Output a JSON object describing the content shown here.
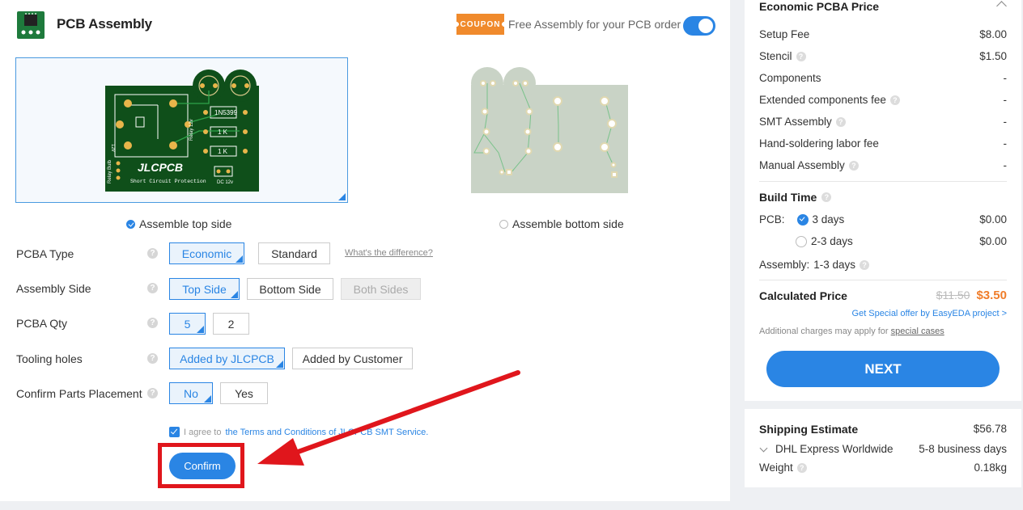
{
  "header": {
    "title": "PCB Assembly",
    "coupon_badge": "COUPON",
    "coupon_text": "Free Assembly for your PCB order"
  },
  "board": {
    "top_label": "Assemble top side",
    "bottom_label": "Assemble bottom side",
    "silkscreen": {
      "brand": "JLCPCB",
      "tagline": "Short Circuit Protection",
      "diode": "1N5399",
      "res1": "1 K",
      "res2": "1 K",
      "dc": "DC 12v",
      "relay": "Relay 12v",
      "relay_bulb": "Relay Bulb",
      "v12": "12v"
    }
  },
  "form": {
    "pcba_type": {
      "label": "PCBA Type",
      "options": [
        "Economic",
        "Standard"
      ],
      "diff_link": "What's the difference?"
    },
    "assembly_side": {
      "label": "Assembly Side",
      "options": [
        "Top Side",
        "Bottom Side",
        "Both Sides"
      ]
    },
    "pcba_qty": {
      "label": "PCBA Qty",
      "options": [
        "5",
        "2"
      ]
    },
    "tooling_holes": {
      "label": "Tooling holes",
      "options": [
        "Added by JLCPCB",
        "Added by Customer"
      ]
    },
    "confirm_placement": {
      "label": "Confirm Parts Placement",
      "options": [
        "No",
        "Yes"
      ]
    },
    "help_glyph": "?",
    "agree_prefix": "I agree to",
    "agree_terms": "the Terms and Conditions of JLCPCB SMT Service.",
    "confirm_label": "Confirm"
  },
  "price_panel": {
    "title": "Economic PCBA Price",
    "rows": [
      {
        "label": "Setup Fee",
        "value": "$8.00"
      },
      {
        "label": "Stencil",
        "value": "$1.50"
      },
      {
        "label": "Components",
        "value": "-"
      },
      {
        "label": "Extended components fee",
        "value": "-"
      },
      {
        "label": "SMT Assembly",
        "value": "-"
      },
      {
        "label": "Hand-soldering labor fee",
        "value": "-"
      },
      {
        "label": "Manual Assembly",
        "value": "-"
      }
    ],
    "build_time": {
      "title": "Build Time",
      "pcb_label": "PCB:",
      "options": [
        {
          "label": "3 days",
          "value": "$0.00"
        },
        {
          "label": "2-3 days",
          "value": "$0.00"
        }
      ],
      "assembly_label": "Assembly:",
      "assembly_value": "1-3 days"
    },
    "calculated": {
      "label": "Calculated Price",
      "old": "$11.50",
      "new": "$3.50"
    },
    "special_offer": "Get Special offer by EasyEDA project >",
    "charges_prefix": "Additional charges may apply for",
    "charges_link": "special cases",
    "next_label": "NEXT"
  },
  "shipping": {
    "title": "Shipping Estimate",
    "price": "$56.78",
    "method": "DHL Express Worldwide",
    "time": "5-8 business days",
    "weight_label": "Weight",
    "weight_value": "0.18kg"
  },
  "colors": {
    "accent": "#2a85e4",
    "price_orange": "#f07d2a",
    "annotation_red": "#e0161c",
    "pcb_green": "#0f4f1a"
  }
}
